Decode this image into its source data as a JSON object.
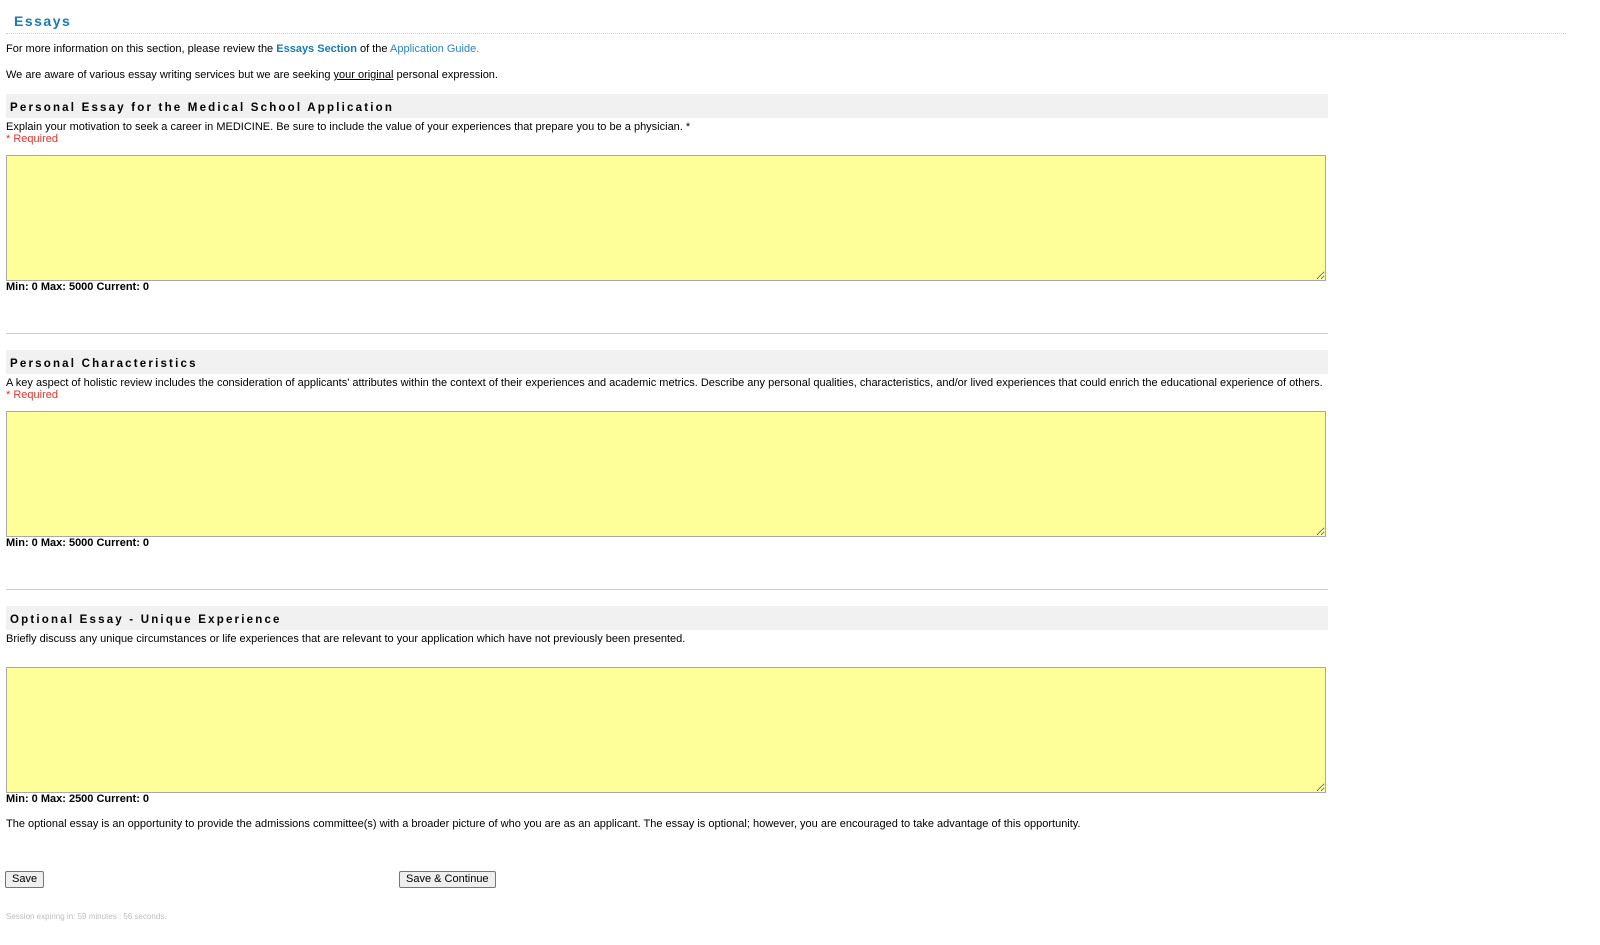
{
  "page": {
    "title": "Essays"
  },
  "intro": {
    "line1_prefix": "For more information on this section, please review the ",
    "line1_link1": "Essays Section",
    "line1_mid": " of the ",
    "line1_link2": "Application Guide.",
    "line2_prefix": "We are aware of various essay writing services but we are seeking ",
    "line2_underlined": "your original",
    "line2_suffix": " personal expression."
  },
  "sections": [
    {
      "heading": "Personal Essay for the Medical School Application",
      "description": "Explain your motivation to seek a career in MEDICINE. Be sure to include the value of your experiences that prepare you to be a physician. *",
      "required_text": "* Required",
      "value": "",
      "counter": "Min: 0 Max: 5000 Current: 0"
    },
    {
      "heading": "Personal Characteristics",
      "description": "A key aspect of holistic review includes the consideration of applicants' attributes within the context of their experiences and academic metrics. Describe any personal qualities, characteristics, and/or lived experiences that could enrich the educational experience of others.",
      "required_text": "* Required",
      "value": "",
      "counter": "Min: 0 Max: 5000 Current: 0"
    },
    {
      "heading": "Optional Essay - Unique Experience",
      "description": "Briefly discuss any unique circumstances or life experiences that are relevant to your application which have not previously been presented.",
      "value": "",
      "counter": "Min: 0 Max: 2500 Current: 0"
    }
  ],
  "footer": {
    "note": "The optional essay is an opportunity to provide the admissions committee(s) with a broader picture of who you are as an applicant. The essay is optional; however, you are encouraged to take advantage of this opportunity.",
    "save_label": "Save",
    "save_continue_label": "Save & Continue",
    "session_text": "Session expiring in: 59 minutes : 56 seconds."
  },
  "colors": {
    "title_blue": "#1a7bb5",
    "link_blue": "#2a86c4",
    "required_red": "#e8322a",
    "textarea_yellow": "#ffff99",
    "header_bg": "#f1f1f1"
  }
}
